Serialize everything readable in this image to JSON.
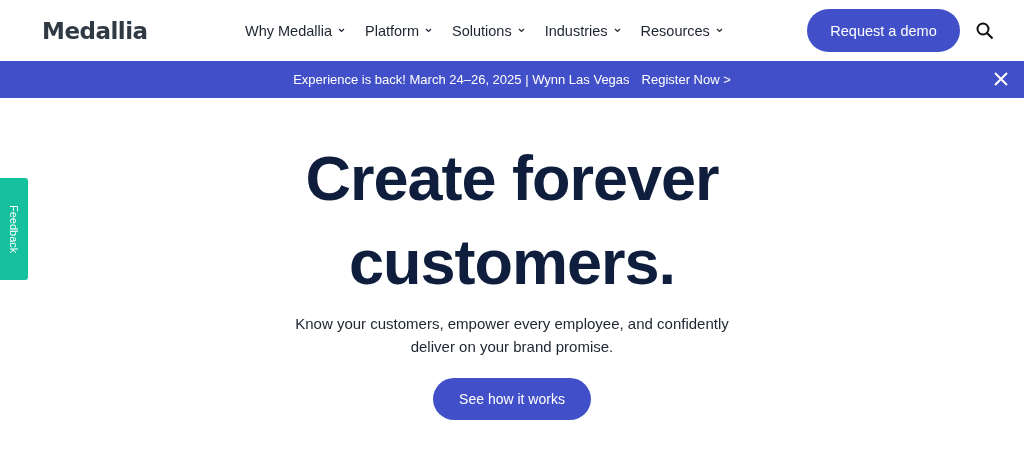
{
  "logo": "Medallia",
  "nav": [
    {
      "label": "Why Medallia"
    },
    {
      "label": "Platform"
    },
    {
      "label": "Solutions"
    },
    {
      "label": "Industries"
    },
    {
      "label": "Resources"
    }
  ],
  "cta": "Request a demo",
  "banner": {
    "text": "Experience is back! March 24–26, 2025 | Wynn Las Vegas",
    "link": "Register Now >"
  },
  "feedback": "Feedback",
  "hero": {
    "title_lines": [
      "Create forever",
      "customers."
    ],
    "subtitle_lines": [
      "Know your customers, empower every employee, and confidently",
      "deliver on your brand promise."
    ],
    "button": "See how it works"
  }
}
